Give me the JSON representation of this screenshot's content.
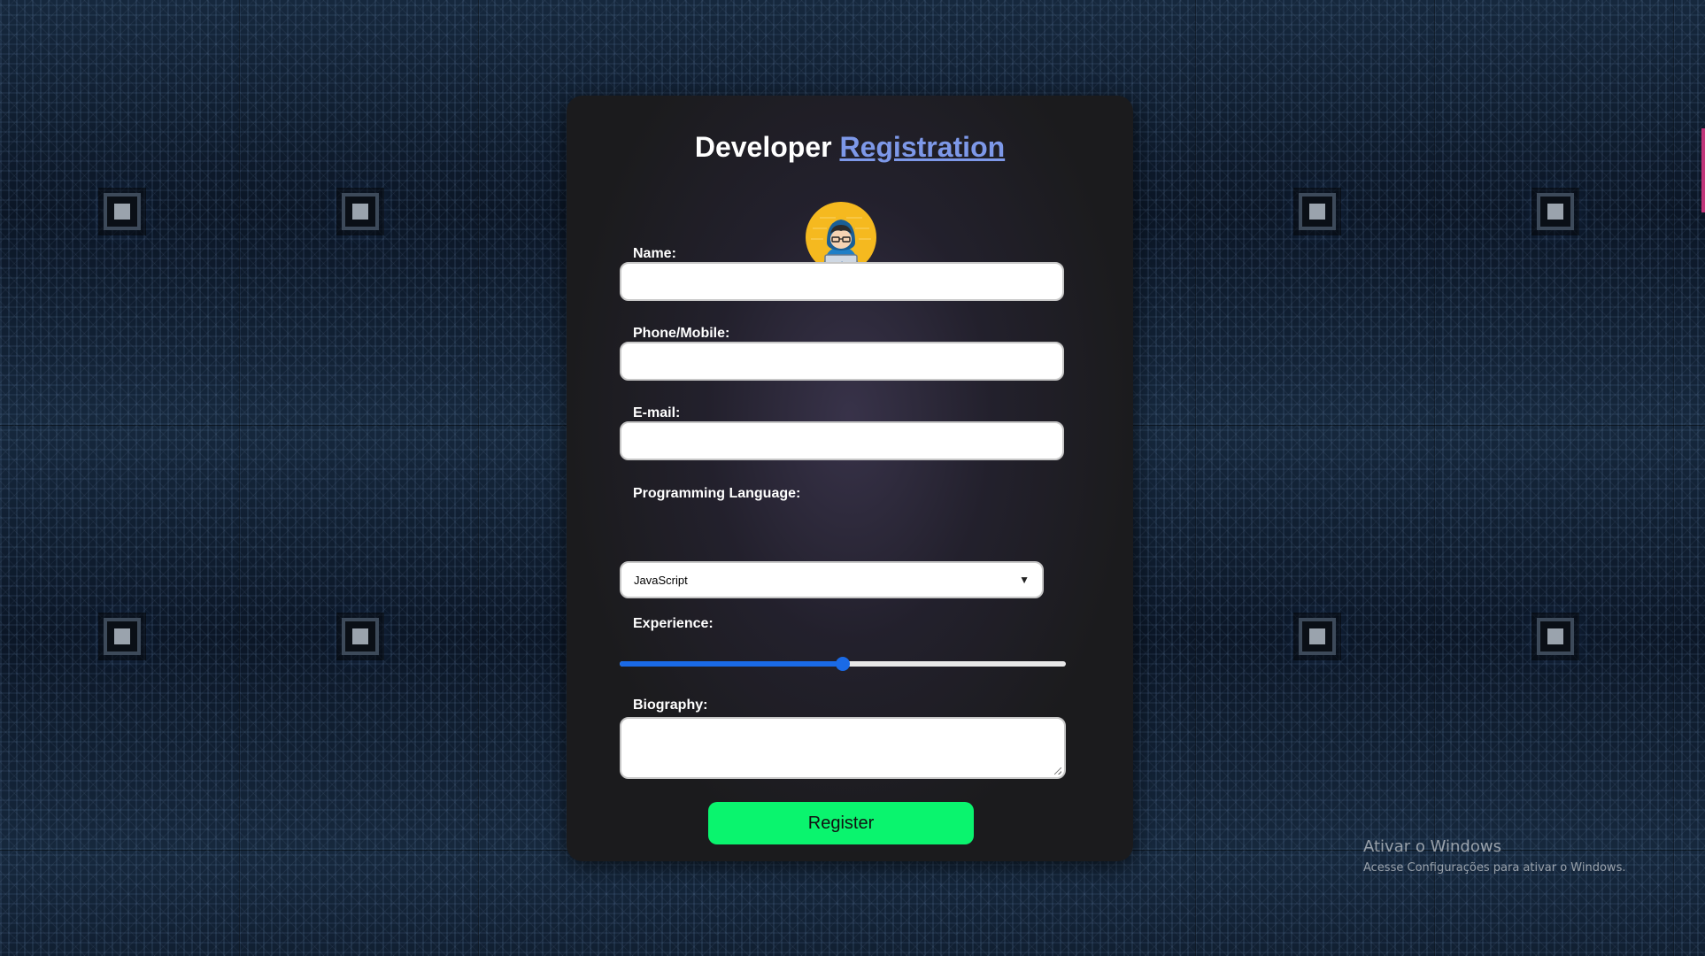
{
  "card": {
    "title_plain": "Developer",
    "title_link": "Registration"
  },
  "avatar": {
    "icon": "developer-with-laptop-icon"
  },
  "form": {
    "name_label": "Name:",
    "name_value": "",
    "phone_label": "Phone/Mobile:",
    "phone_value": "",
    "email_label": "E-mail:",
    "email_value": "",
    "language_label": "Programming Language:",
    "language_selected": "JavaScript",
    "experience_label": "Experience:",
    "experience_value": 0.5,
    "biography_label": "Biography:",
    "biography_value": "",
    "register_label": "Register"
  },
  "colors": {
    "link": "#7d98e8",
    "slider": "#1a6ae6",
    "register_button": "#0af46e",
    "card": "#1b1b1d"
  },
  "windows_watermark": {
    "line1": "Ativar o Windows",
    "line2": "Acesse Configurações para ativar o Windows."
  }
}
